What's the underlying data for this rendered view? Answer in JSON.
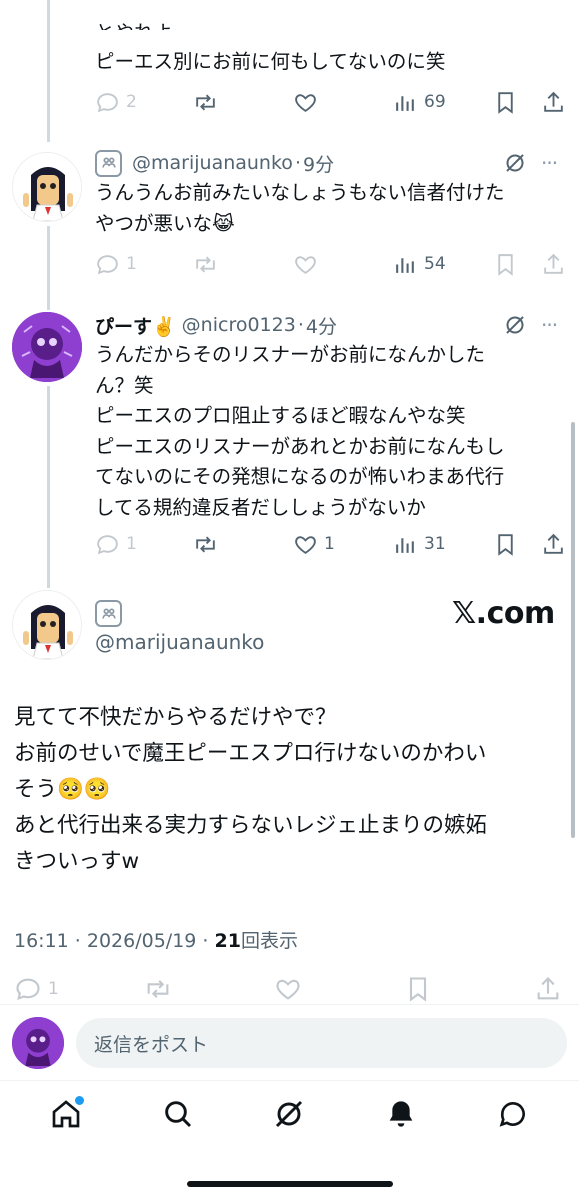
{
  "top_tweet": {
    "partial_line": "とやれよ",
    "text": "ピーエス別にお前に何もしてないのに笑",
    "reply_count": "2",
    "view_count": "69"
  },
  "reply1": {
    "handle": "@marijuanaunko",
    "time": "9分",
    "text": "うんうんお前みたいなしょうもない信者付けた\nやつが悪いな😹",
    "reply_count": "1",
    "view_count": "54"
  },
  "reply2": {
    "name": "ぴーす✌️",
    "handle": "@nicro0123",
    "time": "4分",
    "text": "うんだからそのリスナーがお前になんかした\nん？笑\nピーエスのプロ阻止するほど暇なんやな笑\nピーエスのリスナーがあれとかお前になんもし\nてないのにその発想になるのが怖いわまあ代行\nしてる規約違反者だししょうがないか",
    "reply_count": "1",
    "like_count": "1",
    "view_count": "31"
  },
  "main_tweet": {
    "handle": "@marijuanaunko",
    "brand": "𝕏.com",
    "text": "見てて不快だからやるだけやで？\nお前のせいで魔王ピーエスプロ行けないのかわい\nそう🥺🥺\nあと代行出来る実力すらないレジェ止まりの嫉妬\nきついっすw",
    "timestamp": "16:11 · 2026/05/19 · ",
    "views_number": "21",
    "views_label": "回表示",
    "reply_count": "1"
  },
  "reply_bar": {
    "placeholder": "返信をポスト"
  },
  "nav": {
    "items": [
      "home-icon",
      "search-icon",
      "grok-icon",
      "notifications-icon",
      "messages-icon"
    ],
    "dot_color": "#1d9bf0"
  },
  "colors": {
    "text": "#0f1419",
    "secondary": "#536471",
    "thread_line": "#cfd9de",
    "accent": "#1d9bf0"
  }
}
